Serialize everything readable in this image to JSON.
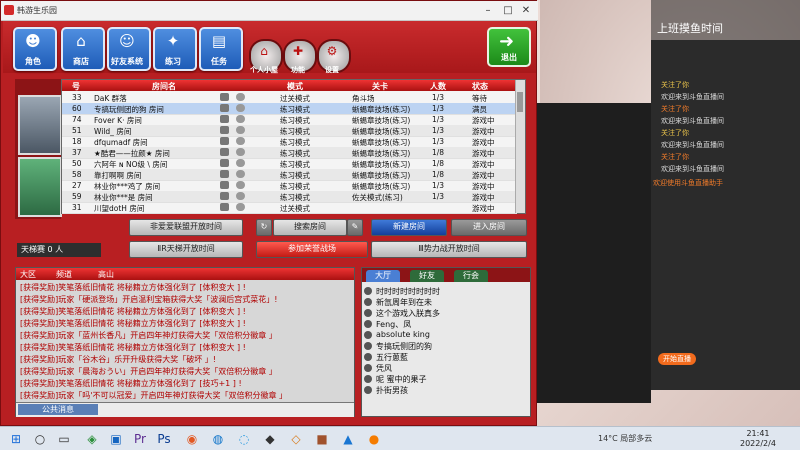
{
  "window": {
    "title": "韩游生乐园"
  },
  "toolbar": {
    "buttons": [
      "角色",
      "商店",
      "好友系统",
      "练习",
      "任务"
    ],
    "round_buttons": [
      "个人小屋",
      "功能",
      "设置"
    ],
    "exit": "退出"
  },
  "table": {
    "headers": [
      "号",
      "房间名",
      "模式",
      "关卡",
      "人数",
      "状态"
    ],
    "rows": [
      {
        "no": "33",
        "name": "DaK 群落",
        "mode": "过关模式",
        "map": "角斗场",
        "count": "1/3",
        "status": "等待"
      },
      {
        "no": "60",
        "name": "专搞玩侧团的狗 房间",
        "mode": "练习模式",
        "map": "蜥蜴章技场(练习)",
        "count": "1/3",
        "status": "满员"
      },
      {
        "no": "74",
        "name": "Fover   K· 房间",
        "mode": "练习模式",
        "map": "蜥蜴章技场(练习)",
        "count": "1/3",
        "status": "游戏中"
      },
      {
        "no": "51",
        "name": "Wild_ 房间",
        "mode": "练习模式",
        "map": "蜥蜴章技场(练习)",
        "count": "1/3",
        "status": "游戏中"
      },
      {
        "no": "18",
        "name": "dfqumadf 房间",
        "mode": "练习模式",
        "map": "蜥蜴章技场(练习)",
        "count": "1/3",
        "status": "游戏中"
      },
      {
        "no": "37",
        "name": "★酷君——拉颜★ 房间",
        "mode": "练习模式",
        "map": "蜥蜴章技场(练习)",
        "count": "1/8",
        "status": "游戏中"
      },
      {
        "no": "50",
        "name": "六阿年 ɴ NO级 \\ 房间",
        "mode": "练习模式",
        "map": "蜥蜴章技场(练习)",
        "count": "1/8",
        "status": "游戏中"
      },
      {
        "no": "58",
        "name": "靠打啊啊 房间",
        "mode": "练习模式",
        "map": "蜥蜴章技场(练习)",
        "count": "1/8",
        "status": "游戏中"
      },
      {
        "no": "27",
        "name": "林业你***鸡了 房间",
        "mode": "练习模式",
        "map": "蜥蜴章技场(练习)",
        "count": "1/3",
        "status": "游戏中"
      },
      {
        "no": "59",
        "name": "林业你***是 房间",
        "mode": "练习模式",
        "map": "佐关模式(练习)",
        "count": "1/3",
        "status": "游戏中"
      },
      {
        "no": "31",
        "name": "川望dotH 房间",
        "mode": "过关模式",
        "map": "",
        "count": "",
        "status": "游戏中"
      }
    ]
  },
  "controls": {
    "b1": "非爱爱联盟开放时间",
    "b2": "搜索房间",
    "b3": "新建房间",
    "b4": "进入房间",
    "b5": "ⅡR天梯开放时间",
    "b6": "参加荣誉战场",
    "b7": "Ⅲ势力战开放时间",
    "ladder": "天梯赛 0 人"
  },
  "chat": {
    "tabs": [
      "大区",
      "频道",
      "高山"
    ],
    "messages": [
      "[获得奖励]笑笔落纸旧情花 将秘籍立方体强化到了 [体积变大 ] !",
      "[获得奖励]玩家「硬派登场」开启温利宝箱获得大奖「波澜后宫式菜花」!",
      "[获得奖励]笑笔落纸旧情花 将秘籍立方体强化到了 [体积变大 ] !",
      "[获得奖励]笑笔落纸旧情花 将秘籍立方体强化到了 [体积变大 ] !",
      "[获得奖励]玩家「蓝州长香凡」开启四年神灯获得大奖「双倍积分徽章 」",
      "[获得奖励]笑笔落纸旧情花 将秘籍立方体强化到了 [体积变大 ] !",
      "[获得奖励]玩家「谷木谷」乐开升级获得大奖「破坏 」!",
      "[获得奖励]玩家「晨海おうい」开启四年神灯获得大奖「双倍积分徽章 」",
      "[获得奖励]笑笔落纸旧情花 将秘籍立方体强化到了 [技巧+1 ] !",
      "[获得奖励]玩家「吗'不可以冠爱」开启四年神灯获得大奖「双倍积分徽章 」"
    ],
    "input_selector": "公共消息"
  },
  "friends": {
    "tabs": [
      "大厅",
      "好友",
      "行会"
    ],
    "list": [
      "时时时时时时时时",
      "新氙周年到在未",
      "这个游戏入朕真多",
      "Feng、凤",
      "absolute king",
      "专搞玩侧团的狗",
      "五行蔥藍",
      "凭风",
      "呢 蜜中的果子",
      "扑街男孩"
    ]
  },
  "stream": {
    "top_text": "上班摸鱼时间",
    "lines": [
      "关注了你",
      "欢迎来到斗鱼直播间",
      "关注了你",
      "欢迎来到斗鱼直播间",
      "关注了你",
      "欢迎来到斗鱼直播间",
      "关注了你",
      "欢迎来到斗鱼直播间"
    ],
    "notice": "欢迎使用斗鱼直播助手",
    "go_live": "开始直播"
  },
  "taskbar": {
    "weather": "14°C 局部多云",
    "time": "21:41",
    "date": "2022/2/4"
  }
}
